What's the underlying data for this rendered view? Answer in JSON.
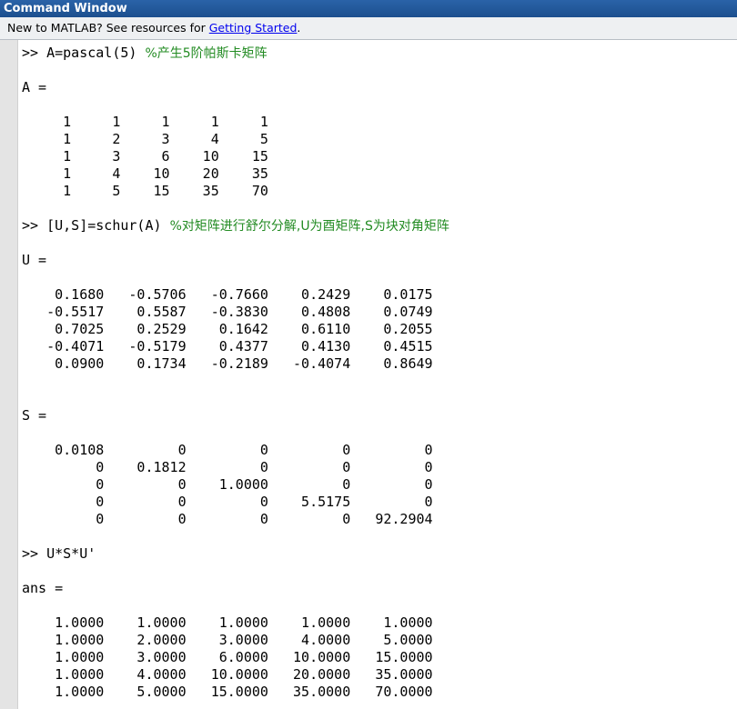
{
  "window": {
    "title": "Command Window"
  },
  "infobar": {
    "text": "New to MATLAB? See resources for ",
    "link": "Getting Started",
    "suffix": "."
  },
  "console": {
    "lines": [
      {
        "t": "cmd",
        "code": ">> A=pascal(5) ",
        "comment": "%产生5阶帕斯卡矩阵"
      },
      {
        "t": "blank"
      },
      {
        "t": "out",
        "text": "A ="
      },
      {
        "t": "blank"
      },
      {
        "t": "out",
        "text": "     1     1     1     1     1"
      },
      {
        "t": "out",
        "text": "     1     2     3     4     5"
      },
      {
        "t": "out",
        "text": "     1     3     6    10    15"
      },
      {
        "t": "out",
        "text": "     1     4    10    20    35"
      },
      {
        "t": "out",
        "text": "     1     5    15    35    70"
      },
      {
        "t": "blank"
      },
      {
        "t": "cmd",
        "code": ">> [U,S]=schur(A) ",
        "comment": "%对矩阵进行舒尔分解,U为酉矩阵,S为块对角矩阵"
      },
      {
        "t": "blank"
      },
      {
        "t": "out",
        "text": "U ="
      },
      {
        "t": "blank"
      },
      {
        "t": "out",
        "text": "    0.1680   -0.5706   -0.7660    0.2429    0.0175"
      },
      {
        "t": "out",
        "text": "   -0.5517    0.5587   -0.3830    0.4808    0.0749"
      },
      {
        "t": "out",
        "text": "    0.7025    0.2529    0.1642    0.6110    0.2055"
      },
      {
        "t": "out",
        "text": "   -0.4071   -0.5179    0.4377    0.4130    0.4515"
      },
      {
        "t": "out",
        "text": "    0.0900    0.1734   -0.2189   -0.4074    0.8649"
      },
      {
        "t": "blank"
      },
      {
        "t": "blank"
      },
      {
        "t": "out",
        "text": "S ="
      },
      {
        "t": "blank"
      },
      {
        "t": "out",
        "text": "    0.0108         0         0         0         0"
      },
      {
        "t": "out",
        "text": "         0    0.1812         0         0         0"
      },
      {
        "t": "out",
        "text": "         0         0    1.0000         0         0"
      },
      {
        "t": "out",
        "text": "         0         0         0    5.5175         0"
      },
      {
        "t": "out",
        "text": "         0         0         0         0   92.2904"
      },
      {
        "t": "blank"
      },
      {
        "t": "cmd",
        "code": ">> U*S*U'",
        "comment": ""
      },
      {
        "t": "blank"
      },
      {
        "t": "out",
        "text": "ans ="
      },
      {
        "t": "blank"
      },
      {
        "t": "out",
        "text": "    1.0000    1.0000    1.0000    1.0000    1.0000"
      },
      {
        "t": "out",
        "text": "    1.0000    2.0000    3.0000    4.0000    5.0000"
      },
      {
        "t": "out",
        "text": "    1.0000    3.0000    6.0000   10.0000   15.0000"
      },
      {
        "t": "out",
        "text": "    1.0000    4.0000   10.0000   20.0000   35.0000"
      },
      {
        "t": "out",
        "text": "    1.0000    5.0000   15.0000   35.0000   70.0000"
      }
    ]
  },
  "colors": {
    "comment": "#228b22",
    "titlebar": "#1c4f8e",
    "link": "#0000ee"
  }
}
